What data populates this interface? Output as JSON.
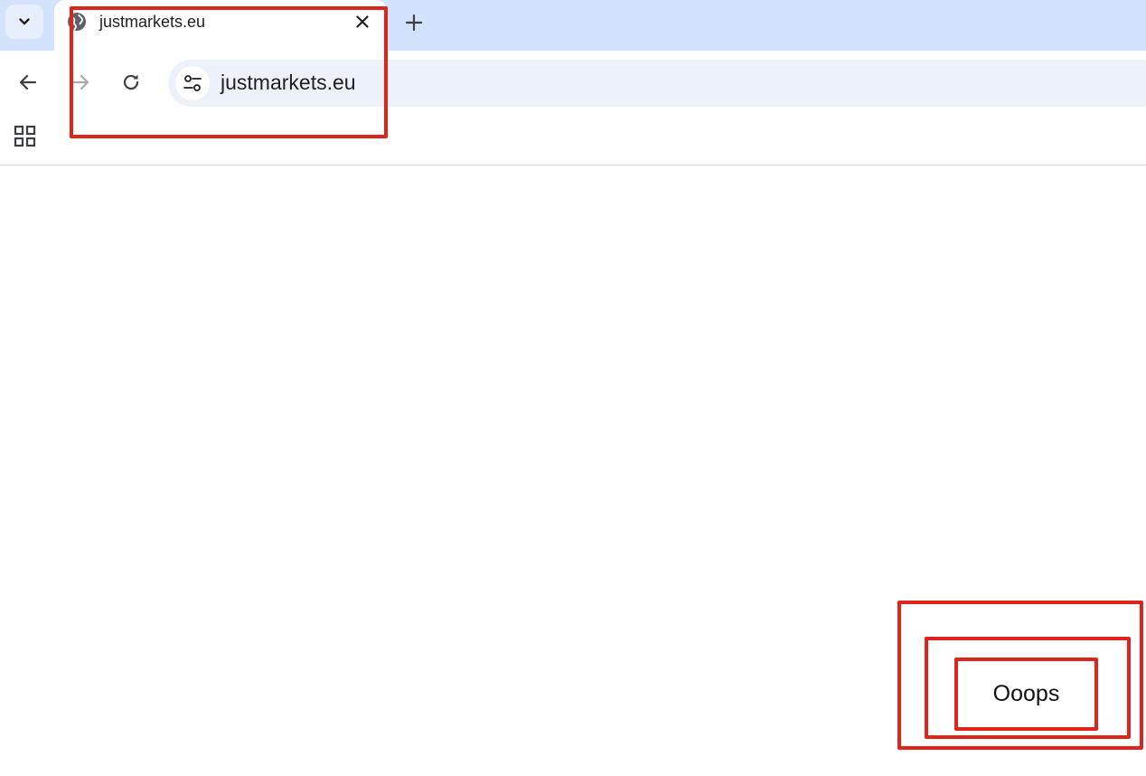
{
  "browser": {
    "tab": {
      "title": "justmarkets.eu",
      "favicon": "globe-icon"
    },
    "tab_search_icon": "chevron-down-icon",
    "close_icon": "close-icon",
    "new_tab_icon": "plus-icon",
    "toolbar": {
      "back_icon": "arrow-left-icon",
      "forward_icon": "arrow-right-icon",
      "reload_icon": "reload-icon",
      "site_info_icon": "tune-icon"
    },
    "omnibox": {
      "url": "justmarkets.eu"
    },
    "bookmarks_bar": {
      "apps_icon": "apps-grid-icon"
    }
  },
  "page": {
    "button_label": "Ooops"
  },
  "colors": {
    "tabstrip_bg": "#d3e3fd",
    "omnibox_bg": "#edf2fa",
    "annotation_red": "#e0241c"
  }
}
